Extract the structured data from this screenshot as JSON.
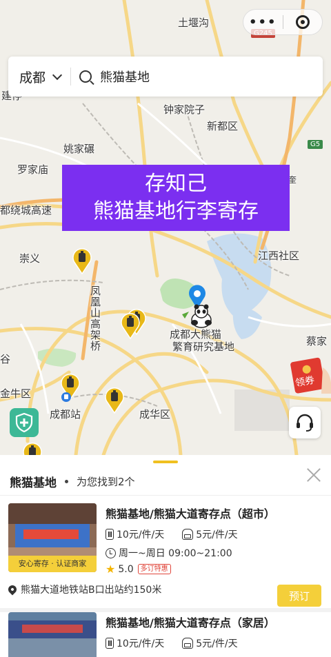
{
  "map": {
    "labels": {
      "tuyangou": "土堰沟",
      "g245": "G245",
      "jianjiating": "建停",
      "zhongjiayuanzi": "钟家院子",
      "xindu": "新都区",
      "yaojiaan": "姚家碾",
      "g5": "G5",
      "luojiamiao": "罗家庙",
      "raocheng": "都绕城高速",
      "chongyi": "崇义",
      "jiangxi": "江西社区",
      "fenghuang": "凤凰山高架桥",
      "panda_base": "成都大熊猫",
      "panda_base2": "繁育研究基地",
      "caijia": "蔡家",
      "gu": "谷",
      "jinniu": "金牛区",
      "chengdu_station": "成都站",
      "chenghua": "成华区",
      "kui": "奎"
    },
    "coupon_label": "领券"
  },
  "capsule": {
    "dots": "•••"
  },
  "search": {
    "city": "成都",
    "query": "熊猫基地"
  },
  "banner": {
    "line1": "存知己",
    "line2": "熊猫基地行李寄存"
  },
  "sheet": {
    "title": "熊猫基地",
    "count_text": "为您找到2个",
    "results": [
      {
        "title": "熊猫基地/熊猫大道寄存点（超市）",
        "price_bag": "10元/件/天",
        "price_pack": "5元/件/天",
        "hours": "周一~周日 09:00~21:00",
        "rating": "5.0",
        "tag": "多订特惠",
        "badge": "安心寄存 · 认证商家",
        "address": "熊猫大道地铁站B口出站约150米",
        "book_label": "预订"
      },
      {
        "title": "熊猫基地/熊猫大道寄存点（家居）",
        "price_bag": "10元/件/天",
        "price_pack": "5元/件/天"
      }
    ]
  },
  "colors": {
    "accent": "#f4cf3a",
    "banner": "#7b2ff0",
    "pin": "#e8b818",
    "location_pin": "#1e88e5",
    "shield": "#3db896",
    "coupon": "#e03a30"
  }
}
